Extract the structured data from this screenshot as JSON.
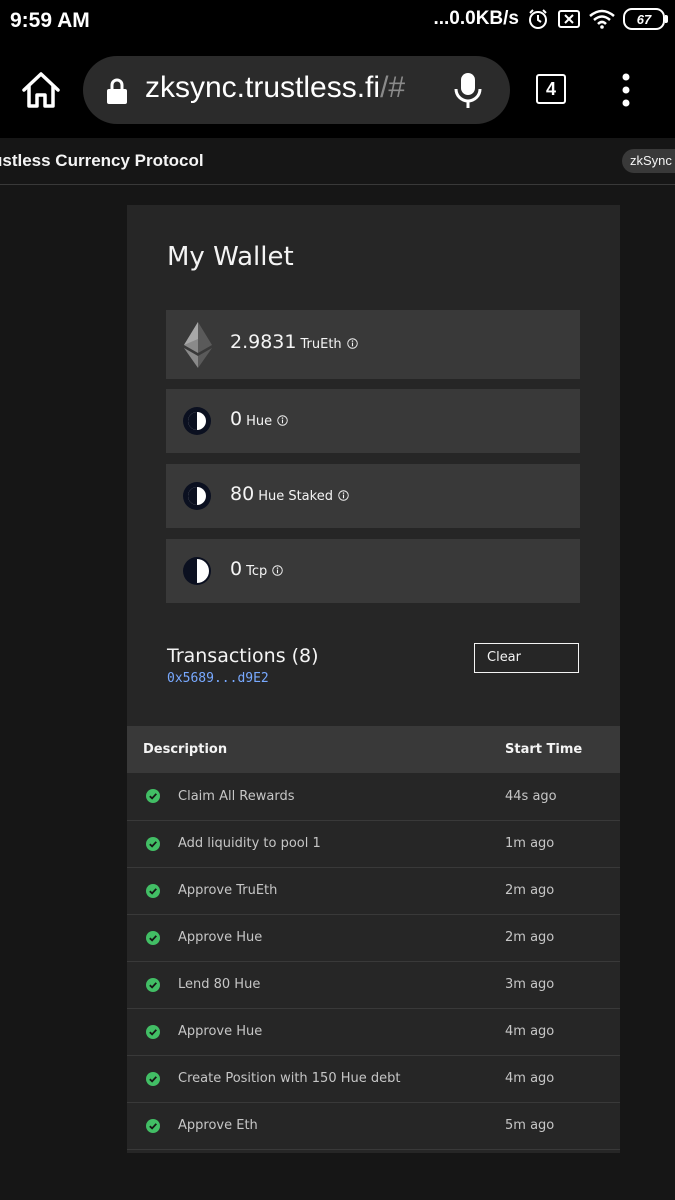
{
  "status_bar": {
    "time": "9:59 AM",
    "network_speed": "...0.0KB/s",
    "battery": "67"
  },
  "browser": {
    "url_main": "zksync.trustless.fi",
    "url_dim": "/#",
    "tab_count": "4"
  },
  "app": {
    "title": "ustless Currency Protocol",
    "network_tag": "zkSync T"
  },
  "wallet": {
    "title": "My Wallet",
    "tokens": [
      {
        "amount": "2.9831",
        "unit": "TruEth",
        "icon": "eth-icon"
      },
      {
        "amount": "0",
        "unit": "Hue",
        "icon": "hue-icon"
      },
      {
        "amount": "80",
        "unit": "Hue Staked",
        "icon": "hue-staked-icon"
      },
      {
        "amount": "0",
        "unit": "Tcp",
        "icon": "tcp-icon"
      }
    ]
  },
  "transactions": {
    "title": "Transactions (8)",
    "address": "0x5689...d9E2",
    "clear_label": "Clear",
    "columns": [
      "Description",
      "Start Time"
    ],
    "rows": [
      {
        "description": "Claim All Rewards",
        "start_time": "44s ago",
        "status": "success"
      },
      {
        "description": "Add liquidity to pool 1",
        "start_time": "1m ago",
        "status": "success"
      },
      {
        "description": "Approve TruEth",
        "start_time": "2m ago",
        "status": "success"
      },
      {
        "description": "Approve Hue",
        "start_time": "2m ago",
        "status": "success"
      },
      {
        "description": "Lend 80 Hue",
        "start_time": "3m ago",
        "status": "success"
      },
      {
        "description": "Approve Hue",
        "start_time": "4m ago",
        "status": "success"
      },
      {
        "description": "Create Position with 150 Hue debt",
        "start_time": "4m ago",
        "status": "success"
      },
      {
        "description": "Approve Eth",
        "start_time": "5m ago",
        "status": "success"
      }
    ]
  },
  "colors": {
    "background": "#161616",
    "card": "#262626",
    "row": "#393939",
    "link": "#78a9ff",
    "success": "#42be65"
  }
}
